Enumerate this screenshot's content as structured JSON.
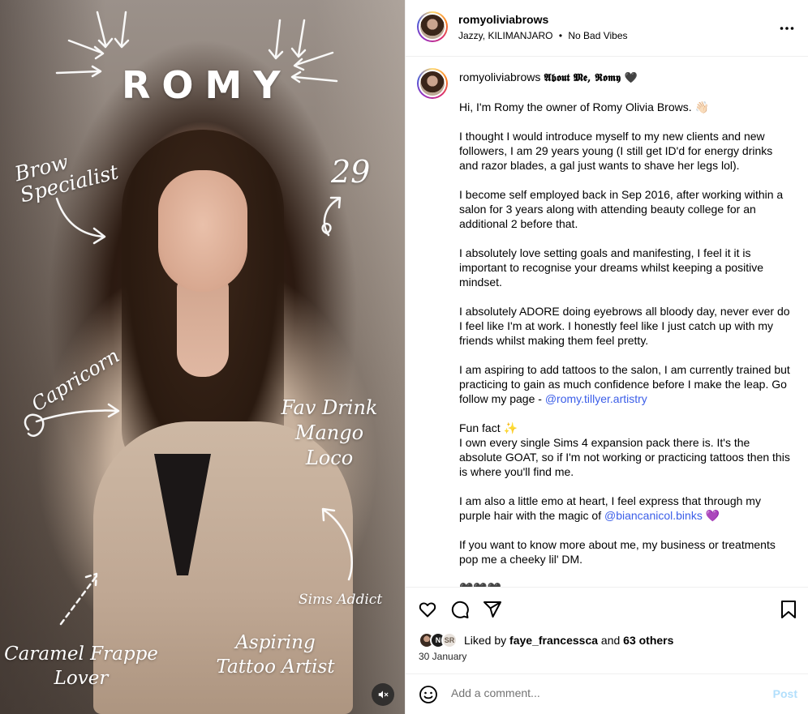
{
  "media": {
    "overlay": {
      "name": "ROMY",
      "brow": "Brow Specialist",
      "age": "29",
      "sign": "Capricorn",
      "drink": "Fav Drink Mango Loco",
      "sims": "Sims Addict",
      "frappe": "Caramel Frappe Lover",
      "artist": "Aspiring Tattoo Artist"
    },
    "mute_icon": "speaker-muted-icon"
  },
  "header": {
    "username": "romyoliviabrows",
    "audio": "Jazzy, KILIMANJARO",
    "separator": "•",
    "audio_extra": "No Bad Vibes",
    "more_icon": "more-horizontal-icon"
  },
  "caption": {
    "username": "romyoliviabrows",
    "title": "𝕬𝖇𝖔𝖚𝖙 𝕸𝖊, 𝕽𝖔𝖒𝖞 🖤",
    "paragraphs": [
      "Hi, I'm Romy the owner of Romy Olivia Brows. 👋🏻",
      "I thought I would introduce myself to my new clients and new followers, I am 29 years young (I still get ID'd for energy drinks and razor blades, a gal just wants to shave her legs lol).",
      "I become self employed back in Sep 2016, after working within a salon for 3 years along with attending beauty college for an additional 2 before that.",
      "I absolutely love setting goals and manifesting, I feel it it is important to recognise your dreams whilst keeping a positive mindset.",
      "I absolutely ADORE doing eyebrows all bloody day, never ever do I feel like I'm at work. I honestly feel like I just catch up with my friends whilst making them feel pretty."
    ],
    "tattoo_text": "I am aspiring to add tattoos to the salon, I am currently trained but practicing to gain as much confidence before I make the leap. Go follow my page - ",
    "tattoo_link": "@romy.tillyer.artistry",
    "fun_fact_title": "Fun fact ✨",
    "fun_fact_text": "I own every single Sims 4 expansion pack there is. It's the absolute GOAT, so if I'm not working or practicing tattoos then this is where you'll find me.",
    "emo_text": "I am also a little emo at heart, I feel express that through my purple hair with the magic of ",
    "emo_link": "@biancanicol.binks",
    "emo_emoji": " 💜",
    "dm_text": "If you want to know more about me, my business or treatments pop me a cheeky lil' DM.",
    "hearts": "🖤🖤🖤"
  },
  "actions": {
    "like_icon": "heart-icon",
    "comment_icon": "comment-bubble-icon",
    "share_icon": "paper-plane-icon",
    "save_icon": "bookmark-icon",
    "liked_by_prefix": "Liked by ",
    "liked_by_user": "faye_francessca",
    "liked_by_and": " and ",
    "liked_by_count": "63 others",
    "liker_avatars": [
      "N",
      "SR"
    ],
    "date": "30 January"
  },
  "add_comment": {
    "emoji_icon": "smiley-icon",
    "placeholder": "Add a comment...",
    "post_label": "Post"
  },
  "colors": {
    "link": "#3b5ee8",
    "post_disabled": "#b2dffc",
    "border": "#efefef"
  }
}
